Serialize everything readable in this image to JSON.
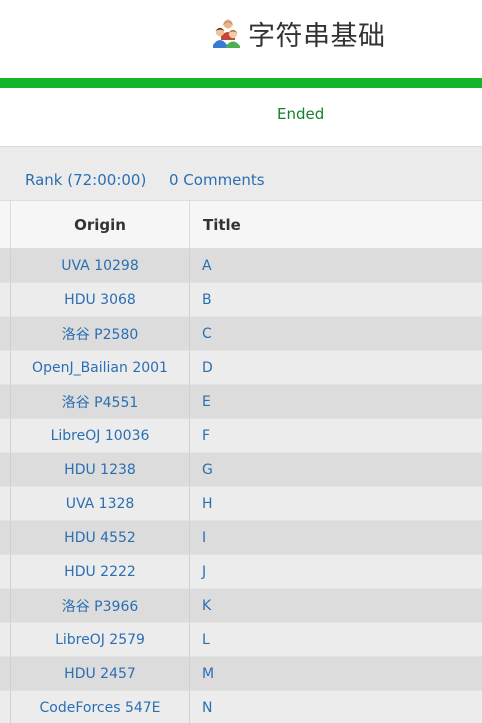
{
  "contest": {
    "title": "字符串基础",
    "icon": "group-users-icon",
    "status": "Ended",
    "progress_percent": 100,
    "progress_color": "#13b52b"
  },
  "links": {
    "rank": "Rank (72:00:00)",
    "comments": "0 Comments"
  },
  "table": {
    "headers": {
      "origin": "Origin",
      "title": "Title"
    },
    "rows": [
      {
        "origin": "UVA 10298",
        "title": "A"
      },
      {
        "origin": "HDU 3068",
        "title": "B"
      },
      {
        "origin": "洛谷 P2580",
        "title": "C"
      },
      {
        "origin": "OpenJ_Bailian 2001",
        "title": "D"
      },
      {
        "origin": "洛谷 P4551",
        "title": "E"
      },
      {
        "origin": "LibreOJ 10036",
        "title": "F"
      },
      {
        "origin": "HDU 1238",
        "title": "G"
      },
      {
        "origin": "UVA 1328",
        "title": "H"
      },
      {
        "origin": "HDU 4552",
        "title": "I"
      },
      {
        "origin": "HDU 2222",
        "title": "J"
      },
      {
        "origin": "洛谷 P3966",
        "title": "K"
      },
      {
        "origin": "LibreOJ 2579",
        "title": "L"
      },
      {
        "origin": "HDU 2457",
        "title": "M"
      },
      {
        "origin": "CodeForces 547E",
        "title": "N"
      }
    ]
  }
}
